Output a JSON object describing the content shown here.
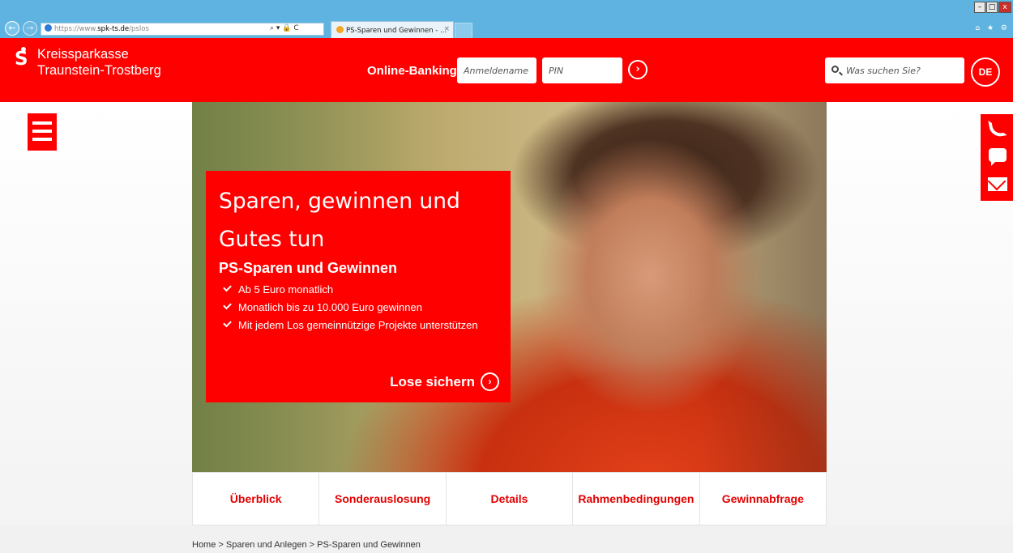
{
  "browser": {
    "address": {
      "prefix": "https://www.",
      "host": "spk-ts.de",
      "path": "/pslos"
    },
    "tab_title": "PS-Sparen und Gewinnen - ...",
    "tab_close": "×",
    "nav_back": "←",
    "nav_forward": "→",
    "addr_icons": "⌕ ▾ 🔒 C",
    "window_minimize": "–",
    "window_maximize": "□",
    "window_close": "x",
    "fav_icons": "⌂ ★ ⚙"
  },
  "header": {
    "logo_line1": "Kreissparkasse",
    "logo_line2": "Traunstein-Trostberg",
    "online_banking_label": "Online-Banking",
    "username_placeholder": "Anmeldename",
    "pin_placeholder": "PIN",
    "login_arrow": "›",
    "search_placeholder": "Was suchen Sie?",
    "language": "DE"
  },
  "promo": {
    "title_line1": "Sparen, gewinnen und",
    "title_line2": "Gutes tun",
    "subtitle": "PS-Sparen und Gewinnen",
    "bullets": [
      "Ab 5 Euro monatlich",
      "Monatlich bis zu 10.000 Euro gewinnen",
      "Mit jedem Los gemeinnützige Projekte unterstützen"
    ],
    "cta_label": "Lose sichern",
    "cta_arrow": "›"
  },
  "tabs": [
    "Überblick",
    "Sonderauslosung",
    "Details",
    "Rahmenbedingungen",
    "Gewinnabfrage"
  ],
  "breadcrumb": "Home > Sparen und Anlegen > PS-Sparen und Gewinnen",
  "colors": {
    "brand_red": "#ff0000",
    "tab_text": "#e30000",
    "chrome_blue": "#5fb3e0"
  }
}
